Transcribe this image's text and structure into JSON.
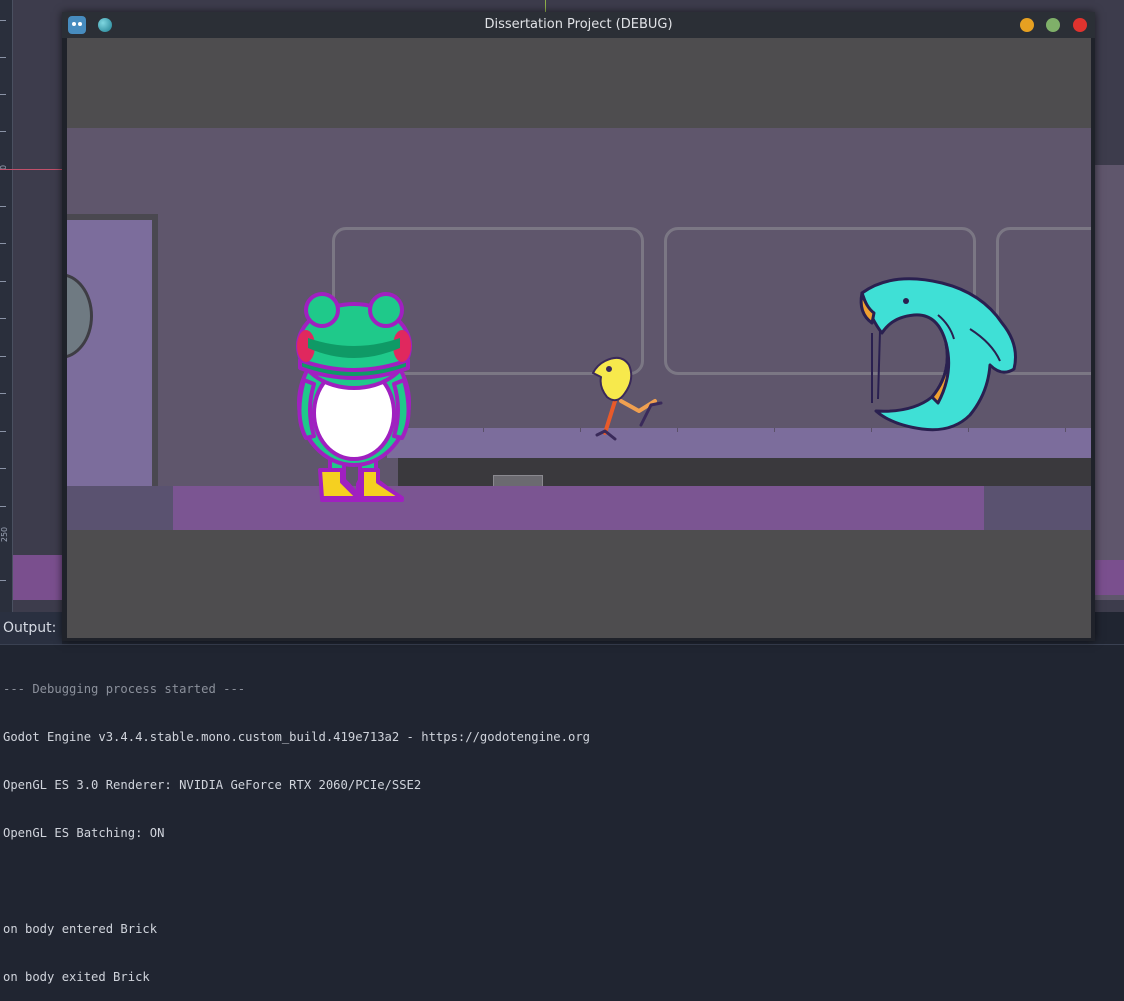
{
  "editor": {
    "ruler_labels": [
      "0",
      "250"
    ]
  },
  "window": {
    "title": "Dissertation Project (DEBUG)",
    "app_icon": "godot-icon",
    "controls": [
      "minimize",
      "maximize",
      "close"
    ],
    "control_colors": {
      "minimize": "#e6a021",
      "maximize": "#7fb069",
      "close": "#e0332e"
    }
  },
  "game": {
    "characters": [
      "frog",
      "bird",
      "shark-monster"
    ],
    "colors": {
      "wall": "#5f566c",
      "floor": "#7b5592",
      "counter": "#7c6d9c",
      "frog_body": "#1fc98a",
      "frog_outline": "#a020c0",
      "bird": "#f7e94c",
      "monster": "#3fe0d6"
    }
  },
  "output": {
    "label": "Output:",
    "lines": [
      "--- Debugging process started ---",
      "Godot Engine v3.4.4.stable.mono.custom_build.419e713a2 - https://godotengine.org",
      "OpenGL ES 3.0 Renderer: NVIDIA GeForce RTX 2060/PCIe/SSE2",
      "OpenGL ES Batching: ON",
      "",
      "on body entered Brick",
      "on body exited Brick"
    ]
  }
}
